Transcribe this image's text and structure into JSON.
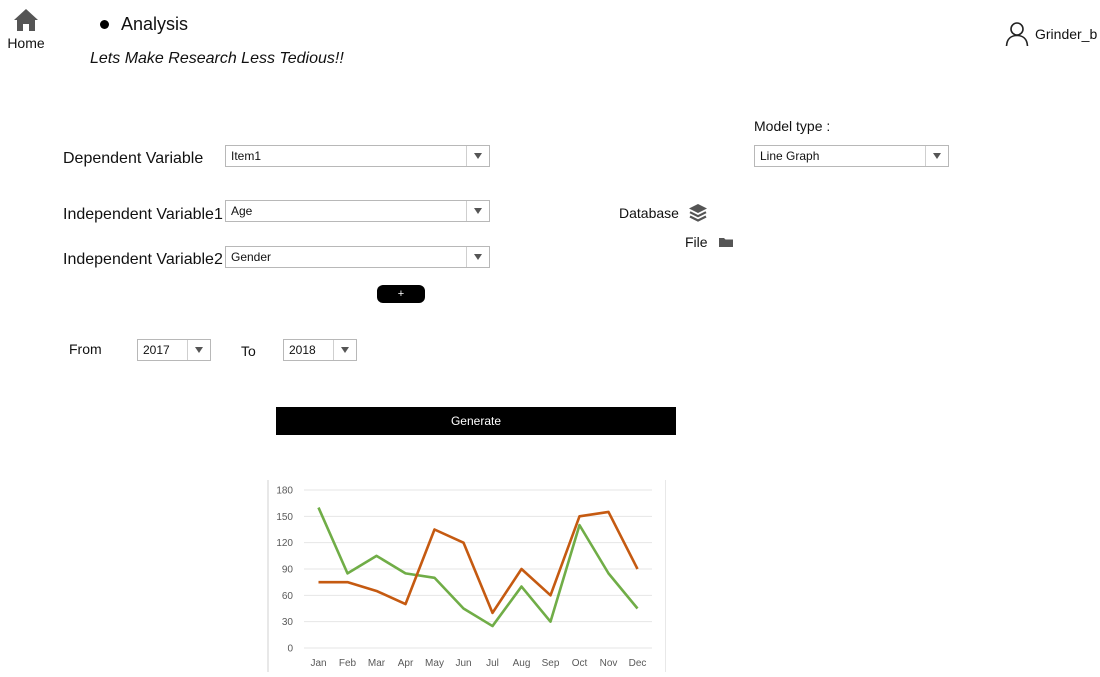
{
  "nav": {
    "home_label": "Home",
    "title": "Analysis",
    "tagline": "Lets Make Research Less Tedious!!",
    "username": "Grinder_b"
  },
  "form": {
    "dependent_label": "Dependent Variable",
    "dependent_value": "Item1",
    "independent1_label": "Independent Variable1",
    "independent1_value": "Age",
    "independent2_label": "Independent Variable2",
    "independent2_value": "Gender",
    "add_label": "+",
    "model_type_label": "Model type :",
    "model_type_value": "Line Graph",
    "database_label": "Database",
    "file_label": "File",
    "from_label": "From",
    "from_value": "2017",
    "to_label": "To",
    "to_value": "2018",
    "generate_label": "Generate"
  },
  "icons": {
    "home": "home-icon",
    "user": "user-icon",
    "database": "layers-icon",
    "file": "folder-icon",
    "dropdown": "chevron-down-icon"
  },
  "colors": {
    "accent": "#000000",
    "series_orange": "#c55a11",
    "series_green": "#70ad47",
    "grid": "#e6e6e6",
    "icon_gray": "#555555"
  },
  "chart_data": {
    "type": "line",
    "categories": [
      "Jan",
      "Feb",
      "Mar",
      "Apr",
      "May",
      "Jun",
      "Jul",
      "Aug",
      "Sep",
      "Oct",
      "Nov",
      "Dec"
    ],
    "series": [
      {
        "color": "#70ad47",
        "values": [
          160,
          85,
          105,
          85,
          80,
          45,
          25,
          70,
          30,
          140,
          85,
          45
        ]
      },
      {
        "color": "#c55a11",
        "values": [
          75,
          75,
          65,
          50,
          135,
          120,
          40,
          90,
          60,
          150,
          155,
          90
        ]
      }
    ],
    "yticks": [
      0,
      30,
      60,
      90,
      120,
      150,
      180
    ],
    "ylim": [
      0,
      180
    ],
    "grid": true,
    "title": "",
    "xlabel": "",
    "ylabel": ""
  }
}
